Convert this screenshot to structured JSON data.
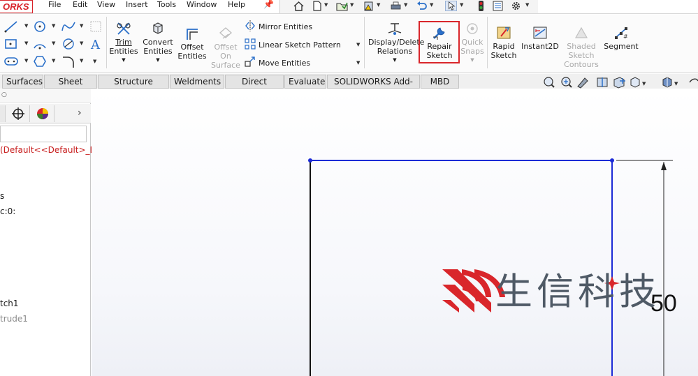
{
  "app": {
    "logo_text": "ORKS"
  },
  "menu": {
    "items": [
      "File",
      "Edit",
      "View",
      "Insert",
      "Tools",
      "Window",
      "Help"
    ]
  },
  "ribbon": {
    "trim": [
      "Trim",
      "Entities"
    ],
    "convert": [
      "Convert",
      "Entities"
    ],
    "offset": [
      "Offset",
      "Entities"
    ],
    "offset_surface": [
      "Offset",
      "On",
      "Surface"
    ],
    "mirror": "Mirror Entities",
    "linear_pattern": "Linear Sketch Pattern",
    "move": "Move Entities",
    "display_delete": [
      "Display/Delete",
      "Relations"
    ],
    "repair": [
      "Repair",
      "Sketch"
    ],
    "quick_snaps": [
      "Quick",
      "Snaps"
    ],
    "rapid": [
      "Rapid",
      "Sketch"
    ],
    "instant2d": "Instant2D",
    "shaded": [
      "Shaded",
      "Sketch",
      "Contours"
    ],
    "segment": "Segment"
  },
  "tabs": [
    "Surfaces",
    "Sheet Metal",
    "Structure System",
    "Weldments",
    "Direct Editing",
    "Evaluate",
    "SOLIDWORKS Add-Ins",
    "MBD"
  ],
  "tree": {
    "config": "(Default<<Default>_D",
    "line_s": "s",
    "line_c0": "c:0:",
    "sketch": "tch1",
    "extrude": "trude1"
  },
  "canvas": {
    "dimension": "50"
  },
  "watermark": {
    "text": "生信科技"
  },
  "colors": {
    "accent_red": "#d9262b",
    "sketch_blue": "#1c2bd6",
    "config_red": "#c81e1e"
  }
}
